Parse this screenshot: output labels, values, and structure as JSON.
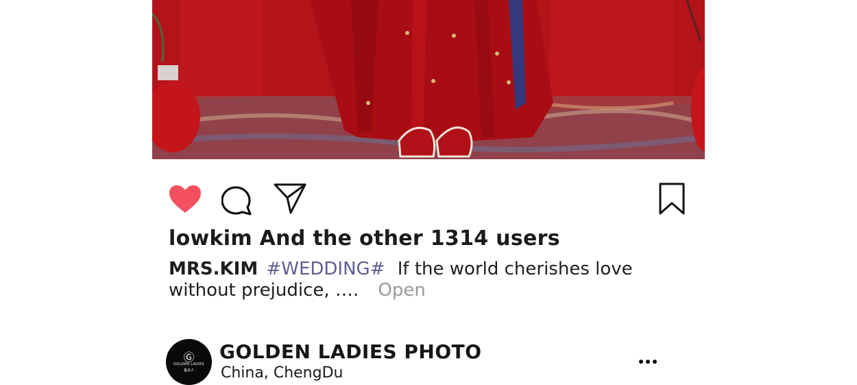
{
  "post": {
    "likes_text": "lowkim And the other 1314 users",
    "caption": {
      "author": "MRS.KIM",
      "hashtag": "#WEDDING#",
      "text": "If the world cherishes love without prejudice,",
      "ellipsis": "….",
      "open_label": "Open"
    },
    "liked": true,
    "like_color": "#f4505f"
  },
  "next_post": {
    "account_name": "GOLDEN LADIES PHOTO",
    "location": "China, ChengDu",
    "avatar_mark": "Ⓖ",
    "avatar_brand": "GOLDEN LADIES",
    "avatar_brand_cn": "金夫人"
  },
  "icons": {
    "like": "heart-icon",
    "comment": "comment-bubble-icon",
    "share": "paper-plane-icon",
    "save": "bookmark-icon",
    "more": "more-dots-icon"
  }
}
